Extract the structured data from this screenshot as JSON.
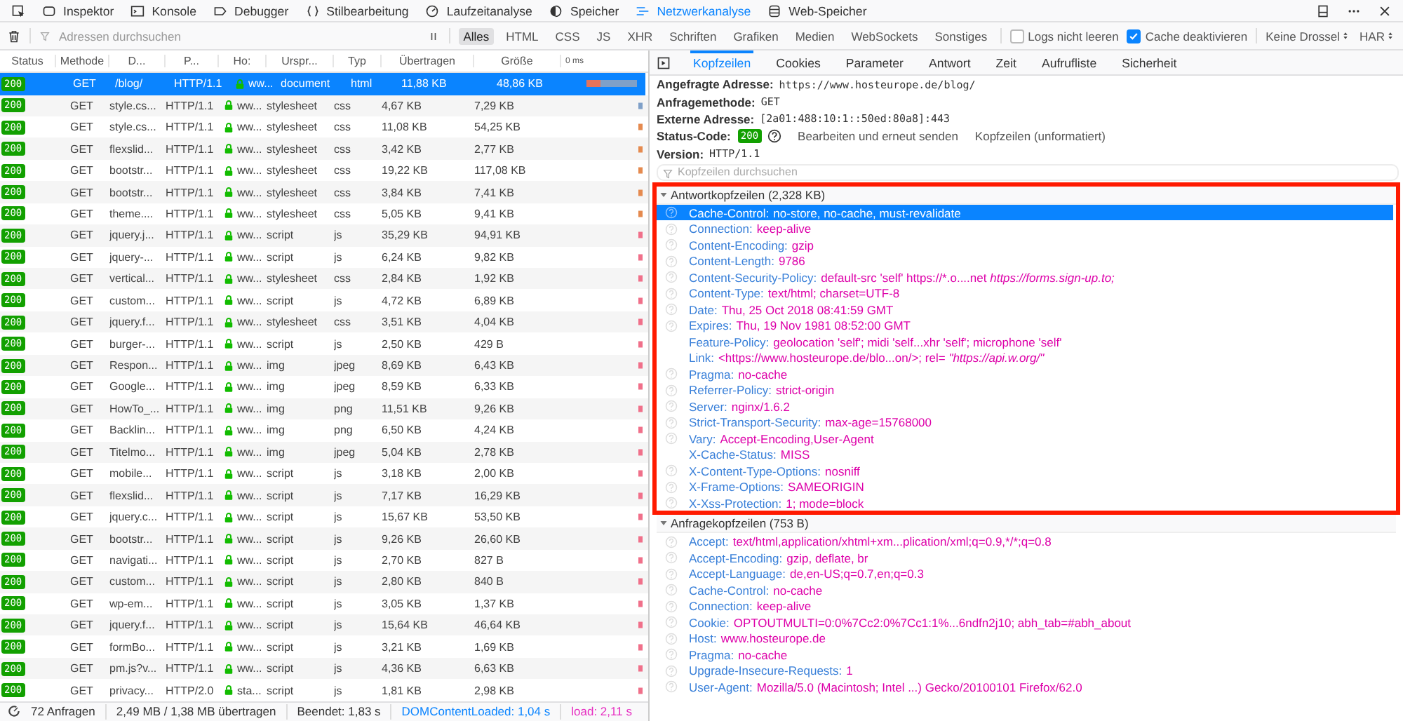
{
  "tools": [
    {
      "label": "Inspektor",
      "selected": false
    },
    {
      "label": "Konsole",
      "selected": false
    },
    {
      "label": "Debugger",
      "selected": false
    },
    {
      "label": "Stilbearbeitung",
      "selected": false
    },
    {
      "label": "Laufzeitanalyse",
      "selected": false
    },
    {
      "label": "Speicher",
      "selected": false
    },
    {
      "label": "Netzwerkanalyse",
      "selected": true
    },
    {
      "label": "Web-Speicher",
      "selected": false
    }
  ],
  "filter": {
    "placeholder": "Adressen durchsuchen"
  },
  "type_filters": [
    {
      "label": "Alles",
      "selected": true
    },
    {
      "label": "HTML",
      "selected": false
    },
    {
      "label": "CSS",
      "selected": false
    },
    {
      "label": "JS",
      "selected": false
    },
    {
      "label": "XHR",
      "selected": false
    },
    {
      "label": "Schriften",
      "selected": false
    },
    {
      "label": "Grafiken",
      "selected": false
    },
    {
      "label": "Medien",
      "selected": false
    },
    {
      "label": "WebSockets",
      "selected": false
    },
    {
      "label": "Sonstiges",
      "selected": false
    }
  ],
  "options": [
    {
      "label": "Logs nicht leeren",
      "checked": false
    },
    {
      "label": "Cache deaktivieren",
      "checked": true
    }
  ],
  "selects": [
    "Keine Drossel",
    "HAR"
  ],
  "table": {
    "columns": [
      "Status",
      "Methode",
      "D...",
      "P...",
      "Ho:",
      "Urspr...",
      "Typ",
      "Übertragen",
      "Größe",
      "0 ms"
    ],
    "rows": [
      {
        "status": "200",
        "method": "GET",
        "file": "/blog/",
        "protocol": "HTTP/1.1",
        "host": "ww...",
        "cause": "document",
        "type": "html",
        "transferred": "11,88 KB",
        "size": "48,86 KB",
        "selected": true
      },
      {
        "status": "200",
        "method": "GET",
        "file": "style.cs...",
        "protocol": "HTTP/1.1",
        "host": "ww...",
        "cause": "stylesheet",
        "type": "css",
        "transferred": "4,67 KB",
        "size": "7,29 KB",
        "selected": false
      },
      {
        "status": "200",
        "method": "GET",
        "file": "style.cs...",
        "protocol": "HTTP/1.1",
        "host": "ww...",
        "cause": "stylesheet",
        "type": "css",
        "transferred": "11,08 KB",
        "size": "54,25 KB",
        "selected": false
      },
      {
        "status": "200",
        "method": "GET",
        "file": "flexslid...",
        "protocol": "HTTP/1.1",
        "host": "ww...",
        "cause": "stylesheet",
        "type": "css",
        "transferred": "3,42 KB",
        "size": "2,77 KB",
        "selected": false
      },
      {
        "status": "200",
        "method": "GET",
        "file": "bootstr...",
        "protocol": "HTTP/1.1",
        "host": "ww...",
        "cause": "stylesheet",
        "type": "css",
        "transferred": "19,22 KB",
        "size": "117,08 KB",
        "selected": false
      },
      {
        "status": "200",
        "method": "GET",
        "file": "bootstr...",
        "protocol": "HTTP/1.1",
        "host": "ww...",
        "cause": "stylesheet",
        "type": "css",
        "transferred": "3,84 KB",
        "size": "7,41 KB",
        "selected": false
      },
      {
        "status": "200",
        "method": "GET",
        "file": "theme....",
        "protocol": "HTTP/1.1",
        "host": "ww...",
        "cause": "stylesheet",
        "type": "css",
        "transferred": "5,05 KB",
        "size": "9,41 KB",
        "selected": false
      },
      {
        "status": "200",
        "method": "GET",
        "file": "jquery.j...",
        "protocol": "HTTP/1.1",
        "host": "ww...",
        "cause": "script",
        "type": "js",
        "transferred": "35,29 KB",
        "size": "94,91 KB",
        "selected": false
      },
      {
        "status": "200",
        "method": "GET",
        "file": "jquery-...",
        "protocol": "HTTP/1.1",
        "host": "ww...",
        "cause": "script",
        "type": "js",
        "transferred": "6,24 KB",
        "size": "9,82 KB",
        "selected": false
      },
      {
        "status": "200",
        "method": "GET",
        "file": "vertical...",
        "protocol": "HTTP/1.1",
        "host": "ww...",
        "cause": "stylesheet",
        "type": "css",
        "transferred": "2,84 KB",
        "size": "1,92 KB",
        "selected": false
      },
      {
        "status": "200",
        "method": "GET",
        "file": "custom...",
        "protocol": "HTTP/1.1",
        "host": "ww...",
        "cause": "script",
        "type": "js",
        "transferred": "4,72 KB",
        "size": "6,89 KB",
        "selected": false
      },
      {
        "status": "200",
        "method": "GET",
        "file": "jquery.f...",
        "protocol": "HTTP/1.1",
        "host": "ww...",
        "cause": "stylesheet",
        "type": "css",
        "transferred": "3,51 KB",
        "size": "4,04 KB",
        "selected": false
      },
      {
        "status": "200",
        "method": "GET",
        "file": "burger-...",
        "protocol": "HTTP/1.1",
        "host": "ww...",
        "cause": "script",
        "type": "js",
        "transferred": "2,50 KB",
        "size": "429 B",
        "selected": false
      },
      {
        "status": "200",
        "method": "GET",
        "file": "Respon...",
        "protocol": "HTTP/1.1",
        "host": "ww...",
        "cause": "img",
        "type": "jpeg",
        "transferred": "8,69 KB",
        "size": "6,43 KB",
        "selected": false
      },
      {
        "status": "200",
        "method": "GET",
        "file": "Google...",
        "protocol": "HTTP/1.1",
        "host": "ww...",
        "cause": "img",
        "type": "jpeg",
        "transferred": "8,59 KB",
        "size": "6,33 KB",
        "selected": false
      },
      {
        "status": "200",
        "method": "GET",
        "file": "HowTo_...",
        "protocol": "HTTP/1.1",
        "host": "ww...",
        "cause": "img",
        "type": "png",
        "transferred": "11,51 KB",
        "size": "9,26 KB",
        "selected": false
      },
      {
        "status": "200",
        "method": "GET",
        "file": "Backlin...",
        "protocol": "HTTP/1.1",
        "host": "ww...",
        "cause": "img",
        "type": "png",
        "transferred": "6,50 KB",
        "size": "4,24 KB",
        "selected": false
      },
      {
        "status": "200",
        "method": "GET",
        "file": "Titelmo...",
        "protocol": "HTTP/1.1",
        "host": "ww...",
        "cause": "img",
        "type": "jpeg",
        "transferred": "5,04 KB",
        "size": "2,78 KB",
        "selected": false
      },
      {
        "status": "200",
        "method": "GET",
        "file": "mobile...",
        "protocol": "HTTP/1.1",
        "host": "ww...",
        "cause": "script",
        "type": "js",
        "transferred": "3,18 KB",
        "size": "2,00 KB",
        "selected": false
      },
      {
        "status": "200",
        "method": "GET",
        "file": "flexslid...",
        "protocol": "HTTP/1.1",
        "host": "ww...",
        "cause": "script",
        "type": "js",
        "transferred": "7,17 KB",
        "size": "16,29 KB",
        "selected": false
      },
      {
        "status": "200",
        "method": "GET",
        "file": "jquery.c...",
        "protocol": "HTTP/1.1",
        "host": "ww...",
        "cause": "script",
        "type": "js",
        "transferred": "15,67 KB",
        "size": "53,50 KB",
        "selected": false
      },
      {
        "status": "200",
        "method": "GET",
        "file": "bootstr...",
        "protocol": "HTTP/1.1",
        "host": "ww...",
        "cause": "script",
        "type": "js",
        "transferred": "9,26 KB",
        "size": "26,60 KB",
        "selected": false
      },
      {
        "status": "200",
        "method": "GET",
        "file": "navigati...",
        "protocol": "HTTP/1.1",
        "host": "ww...",
        "cause": "script",
        "type": "js",
        "transferred": "2,70 KB",
        "size": "827 B",
        "selected": false
      },
      {
        "status": "200",
        "method": "GET",
        "file": "custom...",
        "protocol": "HTTP/1.1",
        "host": "ww...",
        "cause": "script",
        "type": "js",
        "transferred": "2,80 KB",
        "size": "840 B",
        "selected": false
      },
      {
        "status": "200",
        "method": "GET",
        "file": "wp-em...",
        "protocol": "HTTP/1.1",
        "host": "ww...",
        "cause": "script",
        "type": "js",
        "transferred": "3,05 KB",
        "size": "1,37 KB",
        "selected": false
      },
      {
        "status": "200",
        "method": "GET",
        "file": "jquery.f...",
        "protocol": "HTTP/1.1",
        "host": "ww...",
        "cause": "script",
        "type": "js",
        "transferred": "15,64 KB",
        "size": "46,64 KB",
        "selected": false
      },
      {
        "status": "200",
        "method": "GET",
        "file": "formBo...",
        "protocol": "HTTP/1.1",
        "host": "ww...",
        "cause": "script",
        "type": "js",
        "transferred": "3,21 KB",
        "size": "1,69 KB",
        "selected": false
      },
      {
        "status": "200",
        "method": "GET",
        "file": "pm.js?v...",
        "protocol": "HTTP/1.1",
        "host": "ww...",
        "cause": "script",
        "type": "js",
        "transferred": "4,36 KB",
        "size": "6,63 KB",
        "selected": false
      },
      {
        "status": "200",
        "method": "GET",
        "file": "privacy...",
        "protocol": "HTTP/2.0",
        "host": "sta...",
        "cause": "script",
        "type": "js",
        "transferred": "1,81 KB",
        "size": "2,98 KB",
        "selected": false
      }
    ]
  },
  "status_bar": [
    {
      "text": "72 Anfragen",
      "kind": "plain"
    },
    {
      "text": "2,49 MB / 1,38 MB übertragen",
      "kind": "plain"
    },
    {
      "text": "Beendet: 1,83 s",
      "kind": "plain"
    },
    {
      "text": "DOMContentLoaded: 1,04 s",
      "kind": "dom"
    },
    {
      "text": "load: 2,11 s",
      "kind": "load"
    }
  ],
  "detail_tabs": [
    {
      "label": "Kopfzeilen",
      "selected": true
    },
    {
      "label": "Cookies",
      "selected": false
    },
    {
      "label": "Parameter",
      "selected": false
    },
    {
      "label": "Antwort",
      "selected": false
    },
    {
      "label": "Zeit",
      "selected": false
    },
    {
      "label": "Aufrufliste",
      "selected": false
    },
    {
      "label": "Sicherheit",
      "selected": false
    }
  ],
  "summary": [
    {
      "label": "Angefragte Adresse:",
      "value": "https://www.hosteurope.de/blog/"
    },
    {
      "label": "Anfragemethode:",
      "value": "GET"
    },
    {
      "label": "Externe Adresse:",
      "value": "[2a01:488:10:1::50ed:80a8]:443"
    }
  ],
  "status_code": {
    "label": "Status-Code:",
    "value": "200"
  },
  "actions": [
    "Bearbeiten und erneut senden",
    "Kopfzeilen (unformatiert)"
  ],
  "version": {
    "label": "Version:",
    "value": "HTTP/1.1"
  },
  "header_filter": {
    "placeholder": "Kopfzeilen durchsuchen"
  },
  "sections": [
    {
      "title": "Antwortkopfzeilen (2,328 KB)",
      "expanded": true,
      "highlighted": true,
      "headers": [
        {
          "name": "Cache-Control:",
          "value": "no-store, no-cache, must-revalidate",
          "help": true,
          "selected": true
        },
        {
          "name": "Connection:",
          "value": "keep-alive",
          "help": true,
          "selected": false
        },
        {
          "name": "Content-Encoding:",
          "value": "gzip",
          "help": true,
          "selected": false
        },
        {
          "name": "Content-Length:",
          "value": "9786",
          "help": true,
          "selected": false
        },
        {
          "name": "Content-Security-Policy:",
          "value": "default-src 'self' https://*.o....net",
          "value_italic": "https://forms.sign-up.to;",
          "help": true,
          "selected": false
        },
        {
          "name": "Content-Type:",
          "value": "text/html; charset=UTF-8",
          "help": true,
          "selected": false
        },
        {
          "name": "Date:",
          "value": "Thu, 25 Oct 2018 08:41:59 GMT",
          "help": true,
          "selected": false
        },
        {
          "name": "Expires:",
          "value": "Thu, 19 Nov 1981 08:52:00 GMT",
          "help": true,
          "selected": false
        },
        {
          "name": "Feature-Policy:",
          "value": "geolocation 'self'; midi 'self...xhr 'self'; microphone 'self'",
          "help": false,
          "selected": false
        },
        {
          "name": "Link:",
          "value": "<https://www.hosteurope.de/blo...on/>; rel=",
          "value_italic": "\"https://api.w.org/\"",
          "help": false,
          "selected": false
        },
        {
          "name": "Pragma:",
          "value": "no-cache",
          "help": true,
          "selected": false
        },
        {
          "name": "Referrer-Policy:",
          "value": "strict-origin",
          "help": true,
          "selected": false
        },
        {
          "name": "Server:",
          "value": "nginx/1.6.2",
          "help": true,
          "selected": false
        },
        {
          "name": "Strict-Transport-Security:",
          "value": "max-age=15768000",
          "help": true,
          "selected": false
        },
        {
          "name": "Vary:",
          "value": "Accept-Encoding,User-Agent",
          "help": true,
          "selected": false
        },
        {
          "name": "X-Cache-Status:",
          "value": "MISS",
          "help": false,
          "selected": false
        },
        {
          "name": "X-Content-Type-Options:",
          "value": "nosniff",
          "help": true,
          "selected": false
        },
        {
          "name": "X-Frame-Options:",
          "value": "SAMEORIGIN",
          "help": true,
          "selected": false
        },
        {
          "name": "X-Xss-Protection:",
          "value": "1; mode=block",
          "help": true,
          "selected": false
        }
      ]
    },
    {
      "title": "Anfragekopfzeilen (753 B)",
      "expanded": true,
      "highlighted": false,
      "headers": [
        {
          "name": "Accept:",
          "value": "text/html,application/xhtml+xm...plication/xml;q=0.9,*/*;q=0.8",
          "help": true,
          "selected": false
        },
        {
          "name": "Accept-Encoding:",
          "value": "gzip, deflate, br",
          "help": true,
          "selected": false
        },
        {
          "name": "Accept-Language:",
          "value": "de,en-US;q=0.7,en;q=0.3",
          "help": true,
          "selected": false
        },
        {
          "name": "Cache-Control:",
          "value": "no-cache",
          "help": true,
          "selected": false
        },
        {
          "name": "Connection:",
          "value": "keep-alive",
          "help": true,
          "selected": false
        },
        {
          "name": "Cookie:",
          "value": "OPTOUTMULTI=0:0%7Cc2:0%7Cc1:1%...6ndfn2j10; abh_tab=#abh_about",
          "help": true,
          "selected": false
        },
        {
          "name": "Host:",
          "value": "www.hosteurope.de",
          "help": true,
          "selected": false
        },
        {
          "name": "Pragma:",
          "value": "no-cache",
          "help": true,
          "selected": false
        },
        {
          "name": "Upgrade-Insecure-Requests:",
          "value": "1",
          "help": true,
          "selected": false
        },
        {
          "name": "User-Agent:",
          "value": "Mozilla/5.0 (Macintosh; Intel ...) Gecko/20100101 Firefox/62.0",
          "help": true,
          "selected": false
        }
      ]
    }
  ]
}
